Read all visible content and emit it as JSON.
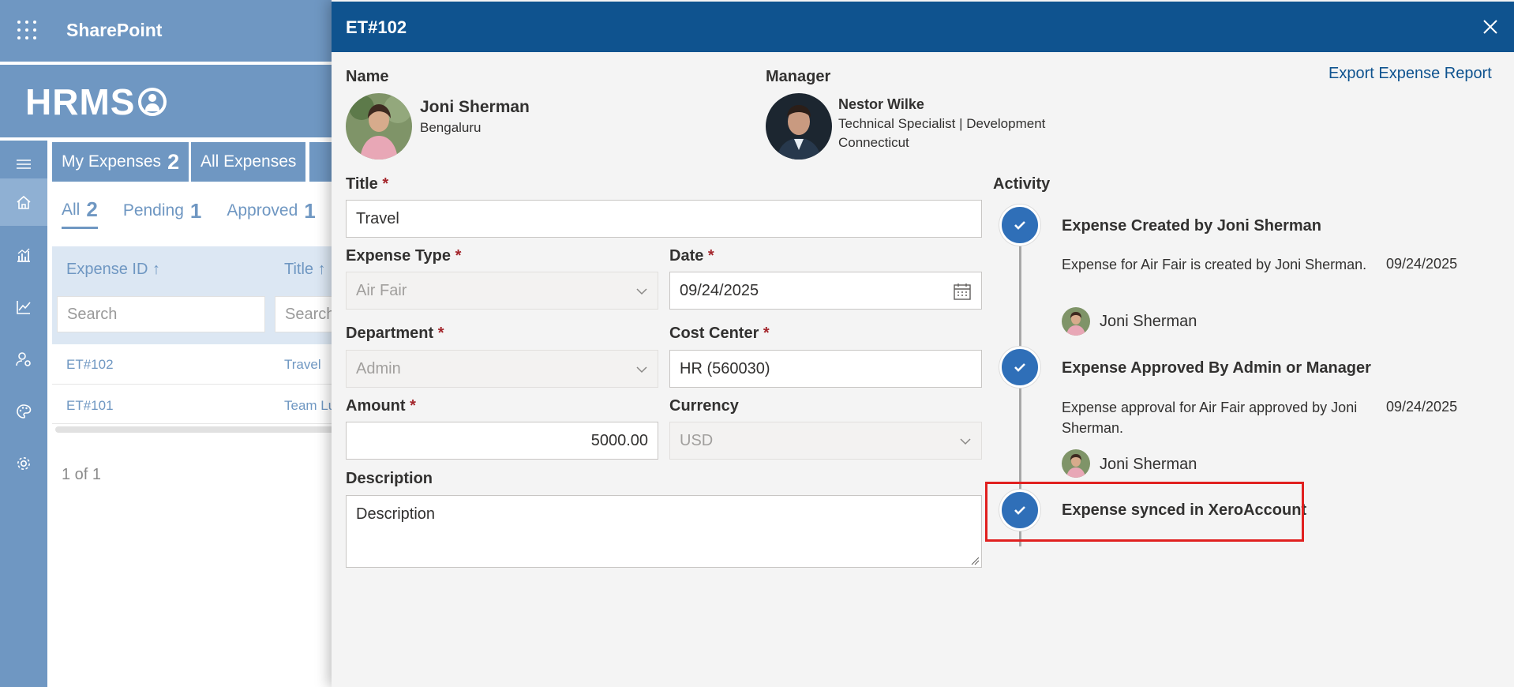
{
  "app": {
    "title": "SharePoint",
    "site_name": "HRMS"
  },
  "tabs": [
    {
      "label": "My Expenses",
      "count": "2"
    },
    {
      "label": "All Expenses"
    }
  ],
  "subtabs": [
    {
      "label": "All",
      "count": "2"
    },
    {
      "label": "Pending",
      "count": "1"
    },
    {
      "label": "Approved",
      "count": "1"
    }
  ],
  "grid": {
    "columns": [
      "Expense ID ↑",
      "Title ↑"
    ],
    "search_placeholder": "Search",
    "search_placeholder_2": "Search",
    "rows": [
      {
        "id": "ET#102",
        "title": "Travel"
      },
      {
        "id": "ET#101",
        "title": "Team Lu"
      }
    ],
    "pager": "1 of 1"
  },
  "panel": {
    "title": "ET#102",
    "export_label": "Export Expense Report",
    "name_label": "Name",
    "manager_label": "Manager",
    "employee": {
      "name": "Joni Sherman",
      "location": "Bengaluru"
    },
    "manager": {
      "name": "Nestor Wilke",
      "role": "Technical Specialist | Development",
      "location": "Connecticut"
    },
    "fields": {
      "title_label": "Title",
      "title_value": "Travel",
      "expense_type_label": "Expense Type",
      "expense_type_value": "Air Fair",
      "date_label": "Date",
      "date_value": "09/24/2025",
      "department_label": "Department",
      "department_value": "Admin",
      "cost_center_label": "Cost Center",
      "cost_center_value": "HR (560030)",
      "amount_label": "Amount",
      "amount_value": "5000.00",
      "currency_label": "Currency",
      "currency_value": "USD",
      "description_label": "Description",
      "description_value": "Description",
      "required_mark": "*"
    },
    "activity": {
      "label": "Activity",
      "items": [
        {
          "title": "Expense Created by Joni Sherman",
          "desc": "Expense for Air Fair is created by Joni Sherman.",
          "date": "09/24/2025",
          "user": "Joni Sherman"
        },
        {
          "title": "Expense Approved By Admin or Manager",
          "desc": "Expense approval for Air Fair approved by Joni Sherman.",
          "date": "09/24/2025",
          "user": "Joni Sherman"
        },
        {
          "title": "Expense synced in XeroAccount"
        }
      ]
    }
  },
  "colors": {
    "panel_header": "#0f538f",
    "accent": "#2f6fb8",
    "background_brand": "#6f97c2",
    "highlight": "#e0201f",
    "required": "#a4262c"
  }
}
